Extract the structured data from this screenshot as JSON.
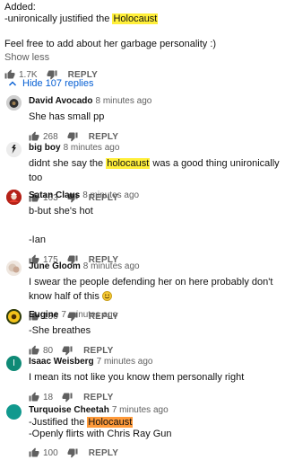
{
  "top_comment": {
    "lines": [
      "Added:",
      "-unironically justified the ",
      "Holocaust",
      "Feel free to add about her garbage personality :)"
    ],
    "show_less": "Show less",
    "likes": "1.7K",
    "reply_label": "REPLY"
  },
  "hide_replies": "Hide 107 replies",
  "comments": [
    {
      "author": "David Avocado",
      "time": "8 minutes ago",
      "text1": "She has small pp",
      "likes": "268",
      "reply": "REPLY",
      "avatar_color": "#3a3a3a"
    },
    {
      "author": "big boy",
      "time": "8 minutes ago",
      "text_pre": "didnt she say the ",
      "text_hl": "holocaust",
      "text_post": " was a good thing unironically too",
      "likes": "163",
      "reply": "REPLY",
      "avatar_color": "#e9e9e9"
    },
    {
      "author": "Satan Claus",
      "time": "8 minutes ago",
      "text1": "b-but she's hot",
      "text2": "-Ian",
      "likes": "175",
      "reply": "REPLY",
      "avatar_color": "#c0281c"
    },
    {
      "author": "June Gloom",
      "time": "8 minutes ago",
      "text1": "I swear the people defending her on here probably don't know half of this",
      "likes": "136",
      "reply": "REPLY",
      "avatar_color": "#efe7e0"
    },
    {
      "author": "Eugine",
      "time": "7 minutes ago",
      "text1": "-She breathes",
      "likes": "80",
      "reply": "REPLY",
      "avatar_color": "#e5b91a"
    },
    {
      "author": "Isaac Weisberg",
      "time": "7 minutes ago",
      "text1": "I mean its not like you know them personally right",
      "likes": "18",
      "reply": "REPLY",
      "avatar_color": "#0f8a76",
      "avatar_letter": "I"
    },
    {
      "author": "Turquoise Cheetah",
      "time": "7 minutes ago",
      "text_pre": "-Justified the ",
      "text_hl": "Holocaust",
      "text2": "-Openly flirts with Chris Ray Gun",
      "likes": "100",
      "reply": "REPLY",
      "avatar_color": "#11998e"
    }
  ],
  "colors": {
    "link": "#065fd4",
    "highlight": "#ffef3a",
    "highlight_orange": "#ff9a3a",
    "muted": "#606060"
  }
}
